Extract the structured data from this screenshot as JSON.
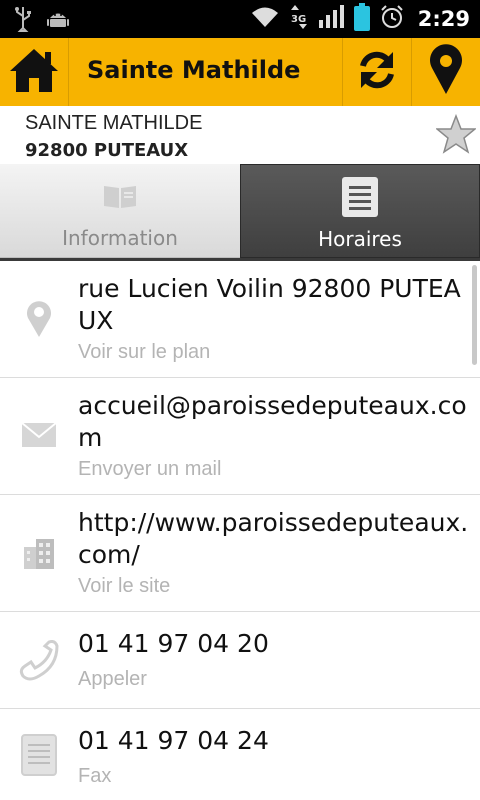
{
  "status_bar": {
    "time": "2:29",
    "icons": [
      "usb-icon",
      "android-icon",
      "wifi-icon",
      "3g-icon",
      "signal-icon",
      "battery-icon",
      "alarm-icon"
    ]
  },
  "action_bar": {
    "title": "Sainte Mathilde",
    "color": "#f7b300",
    "icons": [
      "home-icon",
      "refresh-icon",
      "location-pin-icon"
    ]
  },
  "header": {
    "name": "SAINTE MATHILDE",
    "city": "92800 PUTEAUX",
    "favorite_icon": "star-icon"
  },
  "tabs": [
    {
      "label": "Information",
      "icon": "book-icon",
      "selected": false
    },
    {
      "label": "Horaires",
      "icon": "list-icon",
      "selected": true
    }
  ],
  "items": [
    {
      "main": "rue Lucien Voilin 92800 PUTEAUX",
      "sub": "Voir sur le plan",
      "icon": "map-pin-icon"
    },
    {
      "main": "accueil@paroissedeputeaux.com",
      "sub": "Envoyer un mail",
      "icon": "mail-icon"
    },
    {
      "main": "http://www.paroissedeputeaux.com/",
      "sub": "Voir le site",
      "icon": "building-icon"
    },
    {
      "main": "01 41 97 04 20",
      "sub": "Appeler",
      "icon": "phone-icon"
    },
    {
      "main": "01 41 97 04 24",
      "sub": "Fax",
      "icon": "fax-icon"
    }
  ]
}
